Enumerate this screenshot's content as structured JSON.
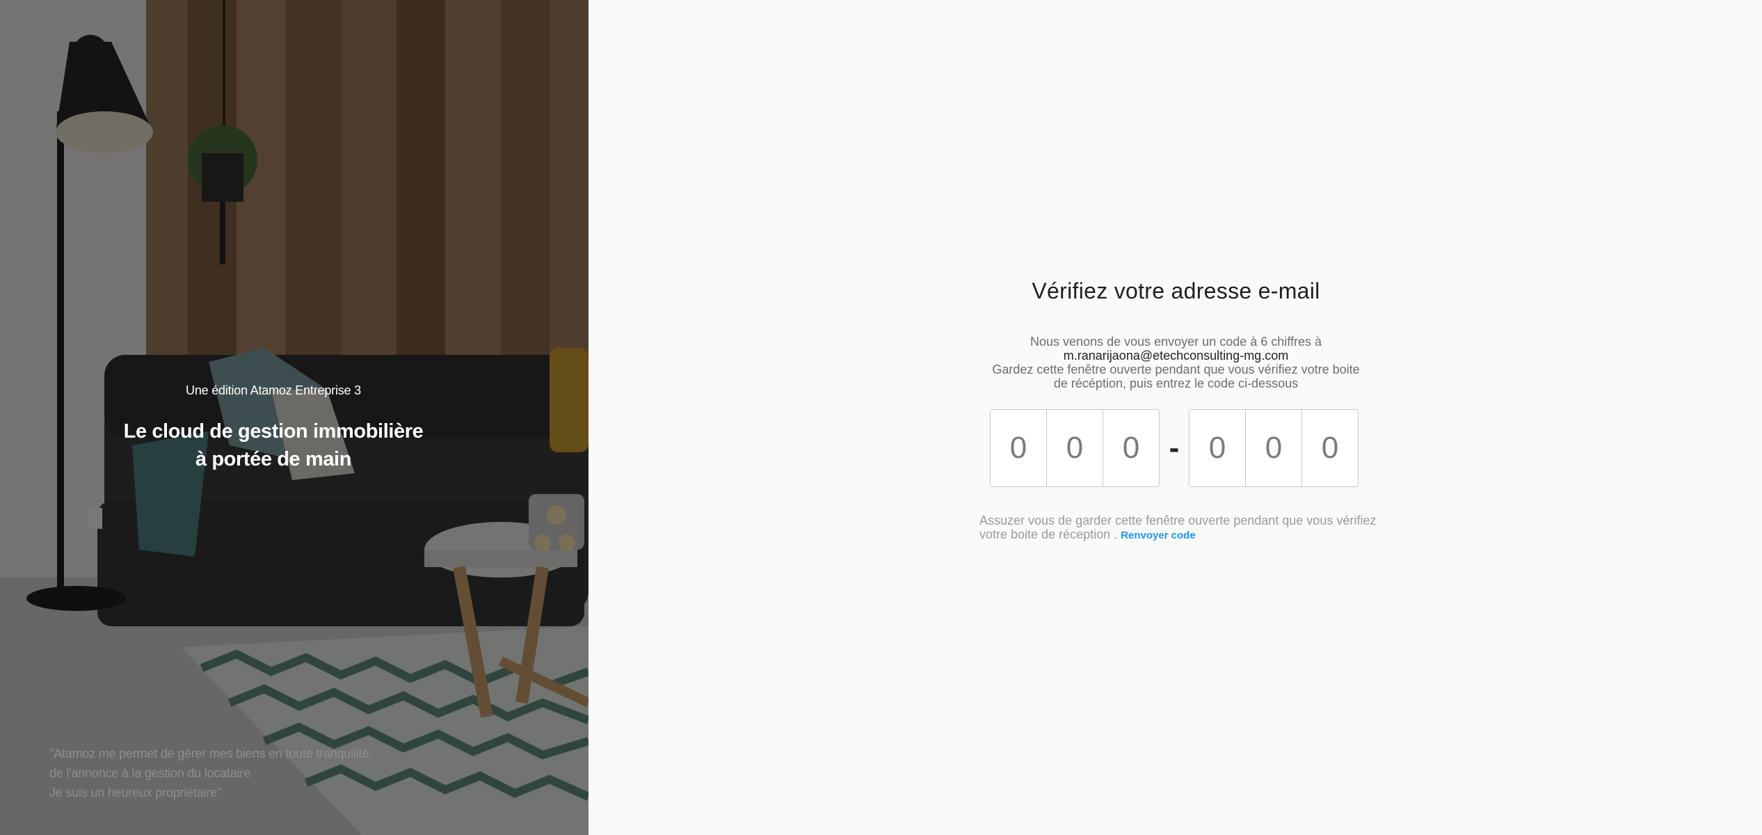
{
  "hero": {
    "edition": "Une édition Atamoz Entreprise 3",
    "title_line1": "Le cloud de gestion immobilière",
    "title_line2": "à portée de main",
    "quote_line1": "\"Atamoz me permet de gérer mes biens en toute tranquilité,",
    "quote_line2": "de l'annonce à la gestion du locataire",
    "quote_line3": "Je suis un heureux propriétaire\""
  },
  "verify": {
    "title": "Vérifiez votre adresse e-mail",
    "desc_line1": "Nous venons de vous envoyer un code à 6 chiffres à",
    "email": "m.ranarijaona@etechconsulting-mg.com",
    "desc_line2": "Gardez cette fenêtre ouverte pendant que vous vérifiez votre boite",
    "desc_line3": "de récéption, puis entrez le code ci-dessous",
    "code_placeholder": "0",
    "code_separator": "-",
    "note_text": "Assuzer vous de garder cette fenêtre ouverte pendant que vous vérifiez votre boite de réception .",
    "resend_label": "Renvoyer code"
  }
}
